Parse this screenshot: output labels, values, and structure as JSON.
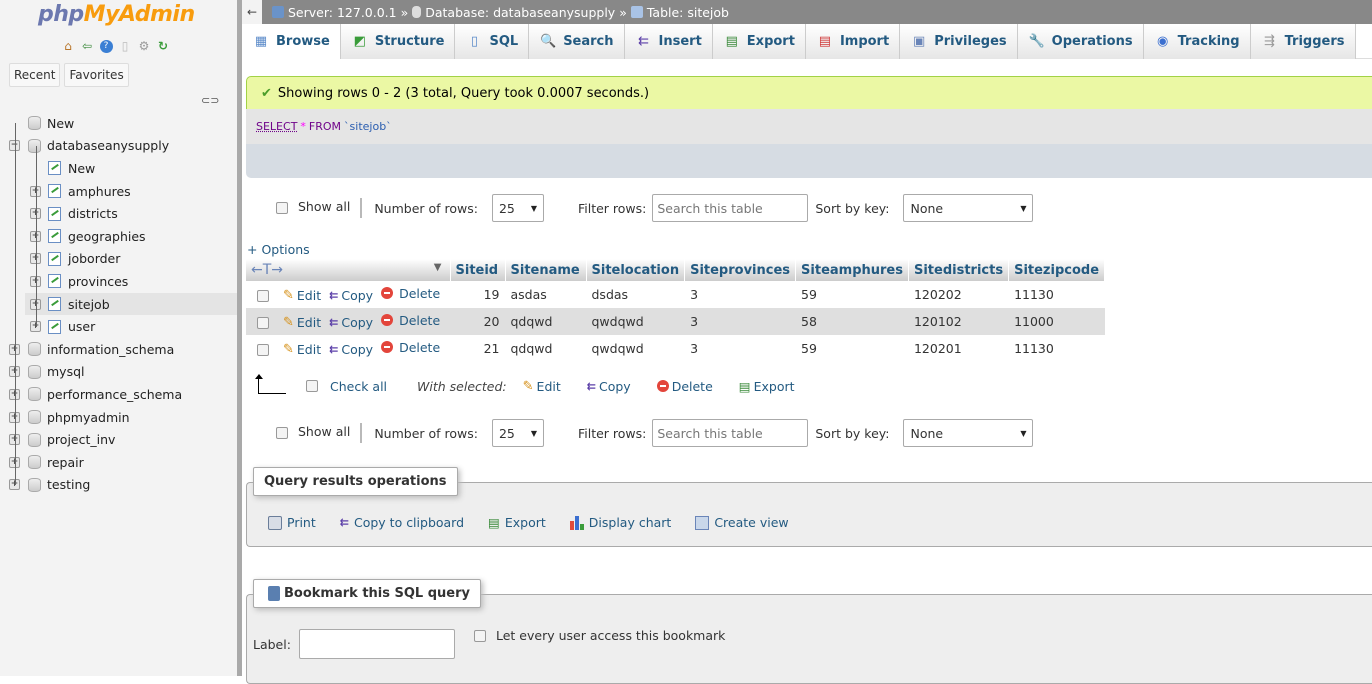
{
  "sidebar": {
    "logo_php": "php",
    "logo_my": "MyAdmin",
    "nav_icons": [
      "home-icon",
      "logout-icon",
      "help-icon",
      "docs-icon",
      "settings-icon",
      "reload-icon"
    ],
    "recent_label": "Recent",
    "favorites_label": "Favorites",
    "tree": [
      {
        "label": "New",
        "level": 0,
        "type": "new-db"
      },
      {
        "label": "databaseanysupply",
        "level": 0,
        "type": "db",
        "expanded": true
      },
      {
        "label": "New",
        "level": 1,
        "type": "new-table"
      },
      {
        "label": "amphures",
        "level": 1,
        "type": "table"
      },
      {
        "label": "districts",
        "level": 1,
        "type": "table"
      },
      {
        "label": "geographies",
        "level": 1,
        "type": "table"
      },
      {
        "label": "joborder",
        "level": 1,
        "type": "table"
      },
      {
        "label": "provinces",
        "level": 1,
        "type": "table"
      },
      {
        "label": "sitejob",
        "level": 1,
        "type": "table",
        "selected": true
      },
      {
        "label": "user",
        "level": 1,
        "type": "table"
      },
      {
        "label": "information_schema",
        "level": 0,
        "type": "db"
      },
      {
        "label": "mysql",
        "level": 0,
        "type": "db"
      },
      {
        "label": "performance_schema",
        "level": 0,
        "type": "db"
      },
      {
        "label": "phpmyadmin",
        "level": 0,
        "type": "db"
      },
      {
        "label": "project_inv",
        "level": 0,
        "type": "db"
      },
      {
        "label": "repair",
        "level": 0,
        "type": "db"
      },
      {
        "label": "testing",
        "level": 0,
        "type": "db"
      }
    ]
  },
  "breadcrumb": {
    "back": "←",
    "server": "Server: 127.0.0.1",
    "database": "Database: databaseanysupply",
    "table": "Table: sitejob",
    "sep": "»"
  },
  "tabs": [
    {
      "label": "Browse",
      "icon": "browse-icon",
      "glyph": "▦",
      "active": true
    },
    {
      "label": "Structure",
      "icon": "structure-icon",
      "glyph": "◩"
    },
    {
      "label": "SQL",
      "icon": "sql-icon",
      "glyph": "▯"
    },
    {
      "label": "Search",
      "icon": "search-icon",
      "glyph": "🔍"
    },
    {
      "label": "Insert",
      "icon": "insert-icon",
      "glyph": "⇇"
    },
    {
      "label": "Export",
      "icon": "export-icon",
      "glyph": "▤"
    },
    {
      "label": "Import",
      "icon": "import-icon",
      "glyph": "▤"
    },
    {
      "label": "Privileges",
      "icon": "privileges-icon",
      "glyph": "▣"
    },
    {
      "label": "Operations",
      "icon": "wrench-icon",
      "glyph": "🔧"
    },
    {
      "label": "Tracking",
      "icon": "eye-icon",
      "glyph": "◉"
    },
    {
      "label": "Triggers",
      "icon": "triggers-icon",
      "glyph": "⇶"
    }
  ],
  "message": {
    "success": "Showing rows 0 - 2 (3 total, Query took 0.0007 seconds.)",
    "sql_select": "SELECT",
    "sql_star": "*",
    "sql_from": "FROM",
    "sql_table": "`sitejob`"
  },
  "navigation": {
    "show_all": "Show all",
    "rows_label": "Number of rows:",
    "rows_value": "25",
    "filter_label": "Filter rows:",
    "filter_placeholder": "Search this table",
    "sort_label": "Sort by key:",
    "sort_value": "None"
  },
  "options_label": "+ Options",
  "table": {
    "columns": [
      "Siteid",
      "Sitename",
      "Sitelocation",
      "Siteprovinces",
      "Siteamphures",
      "Sitedistricts",
      "Sitezipcode"
    ],
    "row_actions": {
      "edit": "Edit",
      "copy": "Copy",
      "delete": "Delete"
    },
    "rows": [
      [
        "19",
        "asdas",
        "dsdas",
        "3",
        "59",
        "120202",
        "11130"
      ],
      [
        "20",
        "qdqwd",
        "qwdqwd",
        "3",
        "58",
        "120102",
        "11000"
      ],
      [
        "21",
        "qdqwd",
        "qwdqwd",
        "3",
        "59",
        "120201",
        "11130"
      ]
    ]
  },
  "with_selected": {
    "check_all": "Check all",
    "label": "With selected:",
    "edit": "Edit",
    "copy": "Copy",
    "delete": "Delete",
    "export": "Export"
  },
  "query_ops": {
    "title": "Query results operations",
    "print": "Print",
    "copy_clipboard": "Copy to clipboard",
    "export": "Export",
    "display_chart": "Display chart",
    "create_view": "Create view"
  },
  "bookmark": {
    "title": "Bookmark this SQL query",
    "label": "Label:",
    "label_value": "",
    "share": "Let every user access this bookmark"
  },
  "colors": {
    "link": "#235a81",
    "success_bg": "#ebf8a4",
    "topbar": "#888888"
  }
}
